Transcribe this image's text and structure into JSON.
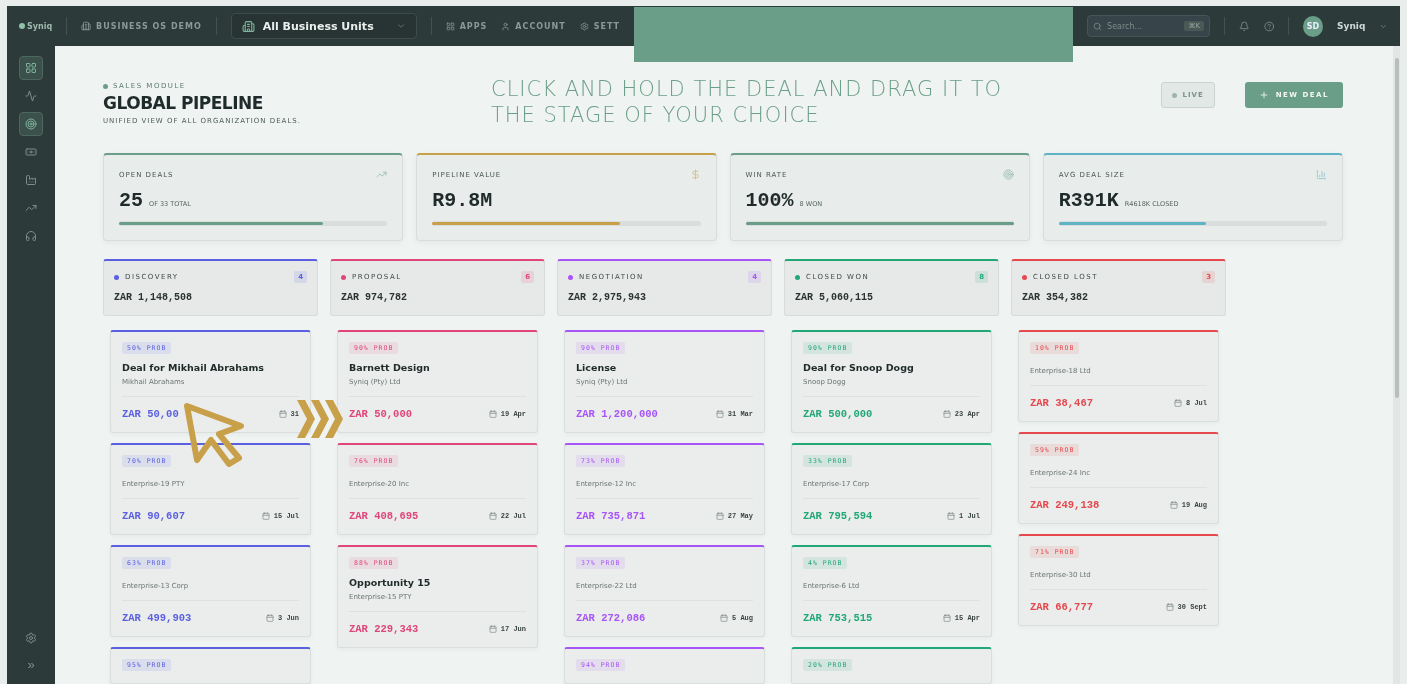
{
  "topbar": {
    "logo": "Syniq",
    "workspace": "BUSINESS OS DEMO",
    "unit_selector": "All Business Units",
    "nav": [
      {
        "kind": "apps",
        "label": "APPS"
      },
      {
        "kind": "account",
        "label": "ACCOUNT"
      },
      {
        "kind": "settings",
        "label": "SETT"
      }
    ],
    "search": {
      "placeholder": "Search...",
      "shortcut": "⌘K"
    },
    "user": {
      "initials": "SD",
      "name": "Syniq"
    }
  },
  "sidebar": {
    "items": [
      {
        "kind": "grid",
        "selected": true
      },
      {
        "kind": "activity",
        "selected": false
      },
      {
        "kind": "target",
        "selected": true
      },
      {
        "kind": "money",
        "selected": false
      },
      {
        "kind": "factory",
        "selected": false
      },
      {
        "kind": "trend",
        "selected": false
      },
      {
        "kind": "headset",
        "selected": false
      }
    ],
    "bottom": [
      {
        "kind": "settings"
      },
      {
        "kind": "expand",
        "label": "»"
      }
    ]
  },
  "header": {
    "eyebrow": "SALES MODULE",
    "title": "GLOBAL PIPELINE",
    "subtitle": "UNIFIED VIEW OF ALL ORGANIZATION DEALS.",
    "live": "LIVE",
    "new_deal": "NEW DEAL"
  },
  "tutorial": {
    "caption": "CLICK AND HOLD THE DEAL AND DRAG IT TO THE STAGE OF YOUR CHOICE"
  },
  "stats": [
    {
      "kind": "trend",
      "label": "OPEN DEALS",
      "value": "25",
      "note": "OF 33 TOTAL",
      "level": 0.76,
      "color": "#6a9e88"
    },
    {
      "kind": "dollar",
      "label": "PIPELINE VALUE",
      "value": "R9.8M",
      "level": 0.7,
      "color": "#c9a04a"
    },
    {
      "kind": "target",
      "label": "WIN RATE",
      "value": "100%",
      "note": "8 WON",
      "level": 1,
      "color": "#6a9e88"
    },
    {
      "kind": "chart",
      "label": "AVG DEAL SIZE",
      "value": "R391K",
      "note": "R4618K CLOSED",
      "level": 0.55,
      "color": "#5fb3c4"
    }
  ],
  "stages": [
    {
      "name": "DISCOVERY",
      "count": "4",
      "total": "ZAR 1,148,508",
      "color": "#5b5fe0",
      "deals": [
        {
          "prob": "50% PROB",
          "title": "Deal for Mikhail Abrahams",
          "company": "Mikhail Abrahams",
          "amount": "ZAR 50,00",
          "date": "31"
        },
        {
          "prob": "70% PROB",
          "company": "Enterprise-19 PTY",
          "amount": "ZAR 90,607",
          "date": "15 Jul"
        },
        {
          "prob": "63% PROB",
          "company": "Enterprise-13 Corp",
          "amount": "ZAR 499,903",
          "date": "3 Jun"
        },
        {
          "prob": "95% PROB"
        }
      ]
    },
    {
      "name": "PROPOSAL",
      "count": "6",
      "total": "ZAR 974,782",
      "color": "#e0457b",
      "deals": [
        {
          "prob": "90% PROB",
          "title": "Barnett Design",
          "company": "Syniq (Pty) Ltd",
          "amount": "ZAR 50,000",
          "date": "19 Apr"
        },
        {
          "prob": "76% PROB",
          "company": "Enterprise-20 Inc",
          "amount": "ZAR 408,695",
          "date": "22 Jul"
        },
        {
          "prob": "88% PROB",
          "title": "Opportunity 15",
          "company": "Enterprise-15 PTY",
          "amount": "ZAR 229,343",
          "date": "17 Jun"
        }
      ]
    },
    {
      "name": "NEGOTIATION",
      "count": "4",
      "total": "ZAR 2,975,943",
      "color": "#a855f7",
      "deals": [
        {
          "prob": "90% PROB",
          "title": "License",
          "company": "Syniq (Pty) Ltd",
          "amount": "ZAR 1,200,000",
          "date": "31 Mar"
        },
        {
          "prob": "73% PROB",
          "company": "Enterprise-12 Inc",
          "amount": "ZAR 735,871",
          "date": "27 May"
        },
        {
          "prob": "37% PROB",
          "company": "Enterprise-22 Ltd",
          "amount": "ZAR 272,086",
          "date": "5 Aug"
        },
        {
          "prob": "94% PROB"
        }
      ]
    },
    {
      "name": "CLOSED WON",
      "count": "8",
      "total": "ZAR 5,060,115",
      "color": "#22a877",
      "deals": [
        {
          "prob": "90% PROB",
          "title": "Deal for Snoop Dogg",
          "company": "Snoop Dogg",
          "amount": "ZAR 500,000",
          "date": "23 Apr"
        },
        {
          "prob": "33% PROB",
          "company": "Enterprise-17 Corp",
          "amount": "ZAR 795,594",
          "date": "1 Jul"
        },
        {
          "prob": "4% PROB",
          "company": "Enterprise-6 Ltd",
          "amount": "ZAR 753,515",
          "date": "15 Apr"
        },
        {
          "prob": "20% PROB"
        }
      ]
    },
    {
      "name": "CLOSED LOST",
      "count": "3",
      "total": "ZAR 354,382",
      "color": "#e5484d",
      "deals": [
        {
          "prob": "10% PROB",
          "company": "Enterprise-18 Ltd",
          "amount": "ZAR 38,467",
          "date": "8 Jul"
        },
        {
          "prob": "59% PROB",
          "company": "Enterprise-24 Inc",
          "amount": "ZAR 249,138",
          "date": "19 Aug"
        },
        {
          "prob": "71% PROB",
          "company": "Enterprise-30 Ltd",
          "amount": "ZAR 66,777",
          "date": "30 Sept"
        }
      ]
    }
  ]
}
